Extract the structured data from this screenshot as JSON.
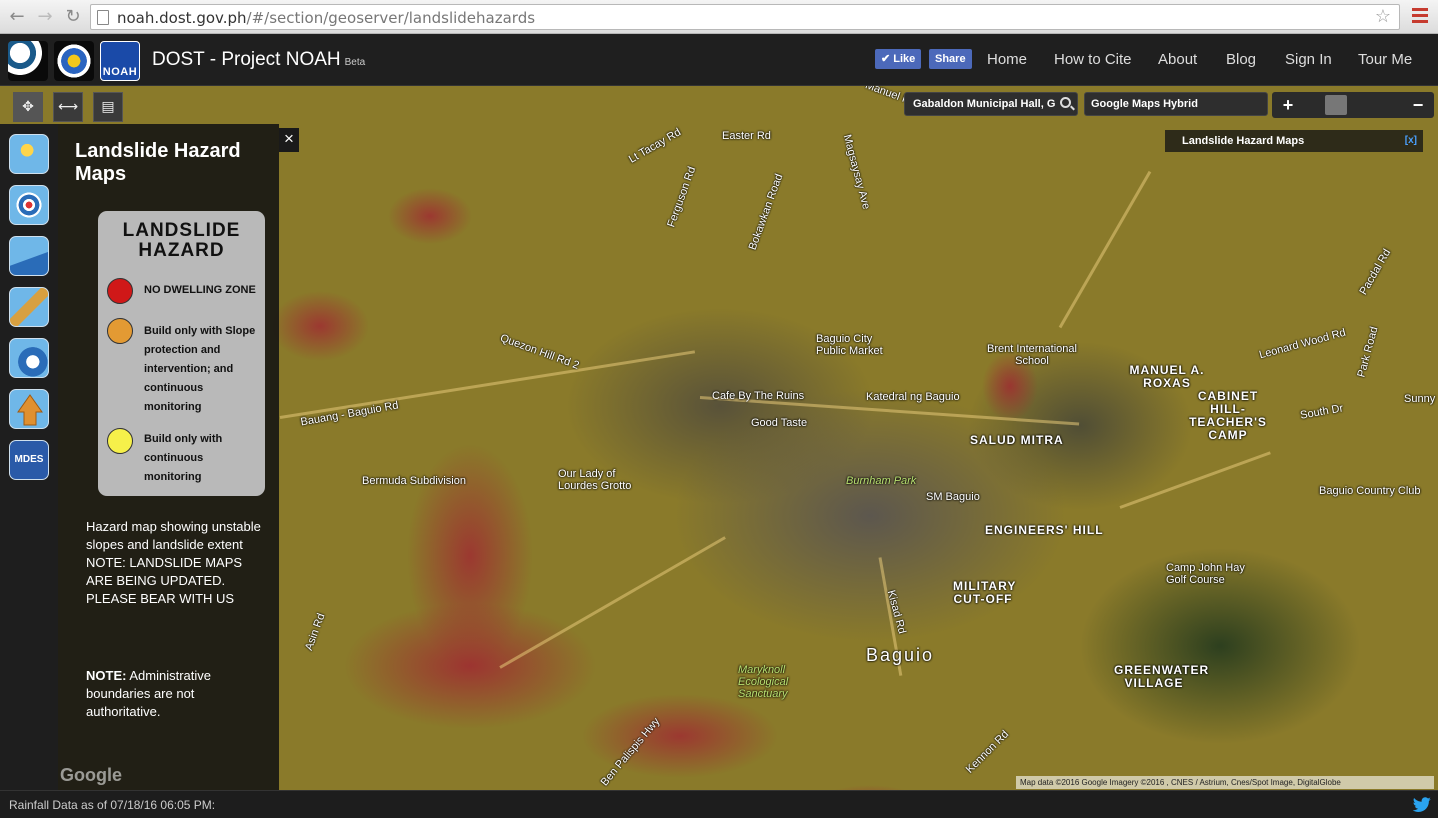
{
  "browser": {
    "url_host": "noah.dost.gov.ph",
    "url_path": "/#/section/geoserver/landslidehazards"
  },
  "header": {
    "logo3_text": "NOAH",
    "title": "DOST - Project NOAH",
    "badge": "Beta",
    "fb_like": "Like",
    "fb_share": "Share",
    "nav": [
      "Home",
      "How to Cite",
      "About",
      "Blog",
      "Sign In",
      "Tour Me"
    ]
  },
  "map_controls": {
    "search_value": "Gabaldon Municipal Hall, G",
    "basemap": "Google Maps Hybrid",
    "zoom_in": "+",
    "zoom_out": "−"
  },
  "layer": {
    "name": "Landslide Hazard Maps",
    "close": "[x]"
  },
  "panel": {
    "title": "Landslide Hazard Maps",
    "close": "×",
    "legend": {
      "title_line1": "LANDSLIDE",
      "title_line2": "HAZARD",
      "items": [
        {
          "label": "NO DWELLING ZONE",
          "color": "#d01818"
        },
        {
          "label": "Build only with Slope protection and intervention; and continuous monitoring",
          "color": "#e39a33"
        },
        {
          "label": "Build only with continuous monitoring",
          "color": "#f6f04a"
        }
      ]
    },
    "description": "Hazard map showing unstable slopes and landslide extent NOTE: LANDSLIDE MAPS ARE BEING UPDATED. PLEASE BEAR WITH US",
    "note_label": "NOTE:",
    "note_text": " Administrative boundaries are not authoritative."
  },
  "map_labels": [
    "Easter Rd",
    "Lt Tacay Rd",
    "Ferguson Rd",
    "Bokawkan Road",
    "Magsaysay Ave",
    "Manuel Ro",
    "Quezon Hill Rd 2",
    "Baguio City Public Market",
    "Brent International School",
    "Bauang - Baguio Rd",
    "Cafe By The Ruins",
    "Katedral ng Baguio",
    "Good Taste",
    "SALUD MITRA",
    "MANUEL A. ROXAS",
    "CABINET HILL-TEACHER'S CAMP",
    "Leonard Wood Rd",
    "Bermuda Subdivision",
    "Our Lady of Lourdes Grotto",
    "Burnham Park",
    "SM Baguio",
    "ENGINEERS' HILL",
    "Baguio Country Club",
    "MILITARY CUT-OFF",
    "Camp John Hay Golf Course",
    "Baguio",
    "GREENWATER VILLAGE",
    "Maryknoll Ecological Sanctuary",
    "Ben Palispis Hwy",
    "Asin Rd",
    "Kisad Rd",
    "South Dr",
    "Pacdal Rd",
    "Park Road",
    "Sunny",
    "Kennon Rd"
  ],
  "google_logo": "Google",
  "attribution": "Map data ©2016 Google Imagery ©2016 , CNES / Astrium, Cnes/Spot Image, DigitalGlobe",
  "footer": {
    "rainfall": "Rainfall Data as of 07/18/16 06:05 PM:"
  }
}
